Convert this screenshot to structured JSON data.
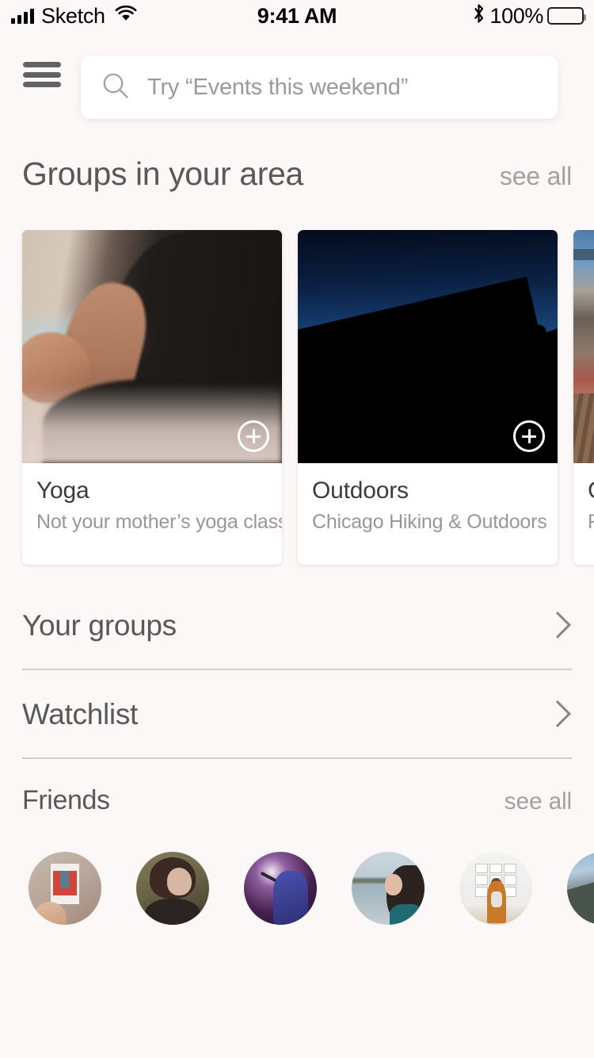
{
  "status_bar": {
    "carrier": "Sketch",
    "time": "9:41 AM",
    "battery_percent": "100%",
    "signal_icon": "signal-bars-icon",
    "wifi_icon": "wifi-icon",
    "bluetooth_icon": "bluetooth-icon",
    "battery_icon": "battery-full-icon"
  },
  "top_bar": {
    "menu_icon": "hamburger-menu-icon",
    "search": {
      "icon": "search-icon",
      "placeholder": "Try “Events this weekend”",
      "value": ""
    }
  },
  "groups_section": {
    "title": "Groups in your area",
    "see_all_label": "see all",
    "add_icon": "plus-circle-icon",
    "cards": [
      {
        "title": "Yoga",
        "subtitle": "Not your mother’s yoga class",
        "image_name": "yoga-meditation-photo",
        "add_label": "+"
      },
      {
        "title": "Outdoors",
        "subtitle": "Chicago Hiking & Outdoors",
        "image_name": "hikers-silhouette-photo",
        "add_label": "+"
      },
      {
        "title": "C",
        "subtitle": "R",
        "image_name": "rooftop-bar-photo",
        "add_label": "+"
      }
    ]
  },
  "nav_rows": [
    {
      "label": "Your groups",
      "chevron_icon": "chevron-right-icon"
    },
    {
      "label": "Watchlist",
      "chevron_icon": "chevron-right-icon"
    }
  ],
  "friends_section": {
    "title": "Friends",
    "see_all_label": "see all",
    "avatars": [
      {
        "name": "friend-avatar-polaroid"
      },
      {
        "name": "friend-avatar-woman-forest"
      },
      {
        "name": "friend-avatar-musician"
      },
      {
        "name": "friend-avatar-woman-lake"
      },
      {
        "name": "friend-avatar-gallery"
      },
      {
        "name": "friend-avatar-mountain"
      }
    ]
  },
  "colors": {
    "background": "#FCF8F7",
    "card_surface": "#FFFFFF",
    "title_text": "#585858",
    "muted_text": "#A5A09E",
    "divider": "#CFCCCA"
  }
}
